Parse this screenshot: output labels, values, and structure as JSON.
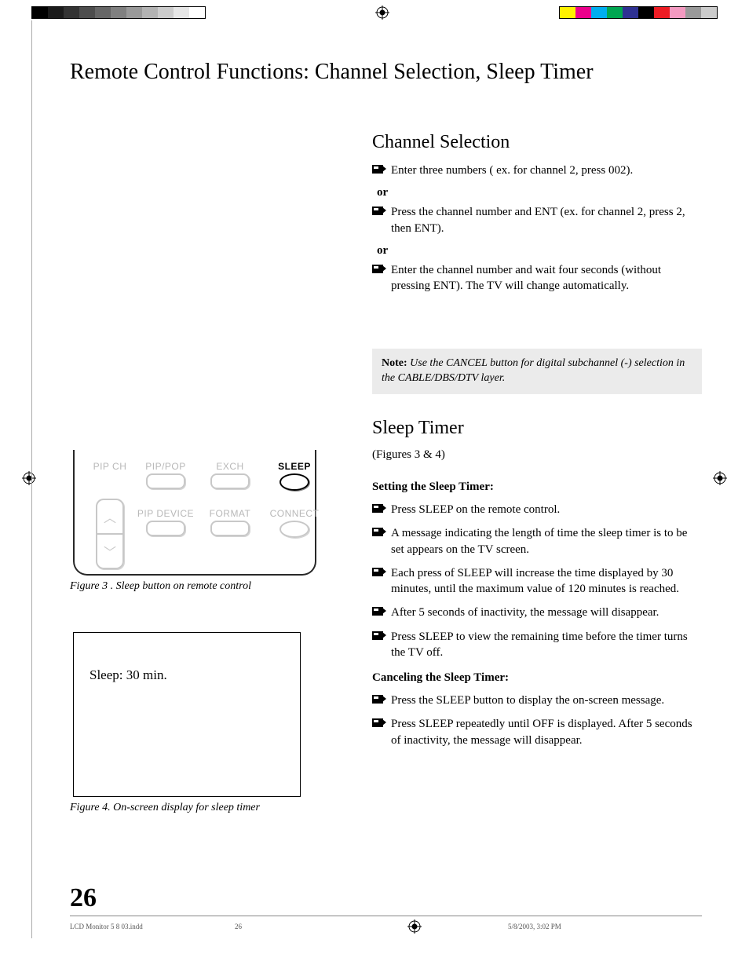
{
  "title": "Remote Control Functions: Channel Selection, Sleep Timer",
  "channel_selection": {
    "heading": "Channel Selection",
    "items": [
      "Enter three numbers ( ex. for channel 2, press 002).",
      "Press the channel number and ENT (ex. for channel 2, press 2, then ENT).",
      "Enter the channel number and wait four seconds (without pressing ENT).  The TV will change automatically."
    ],
    "or": "or"
  },
  "note": {
    "label": "Note:",
    "text": "Use  the CANCEL button for digital subchannel (-) selection in the CABLE/DBS/DTV layer."
  },
  "sleep_timer": {
    "heading": "Sleep Timer",
    "figures_ref": "(Figures 3 & 4)",
    "setting_heading": "Setting the Sleep Timer:",
    "setting_items": [
      "Press SLEEP on the remote control.",
      "A message indicating the length of time the sleep timer is to be set appears on the TV screen.",
      "Each press of SLEEP will increase the time displayed by 30 minutes, until the maximum value of 120 minutes is reached.",
      "After 5 seconds of inactivity, the message will disappear.",
      "Press SLEEP to view the remaining time before the timer turns the TV off."
    ],
    "cancel_heading": "Canceling the Sleep Timer:",
    "cancel_items": [
      "Press the SLEEP button to display the on-screen message.",
      "Press SLEEP repeatedly until OFF is displayed. After 5 seconds of inactivity, the message will disappear."
    ]
  },
  "remote": {
    "labels": {
      "pip_ch": "PIP CH",
      "pip_pop": "PIP/POP",
      "exch": "EXCH",
      "sleep": "SLEEP",
      "pip_device": "PIP DEVICE",
      "format": "FORMAT",
      "connect": "CONNECT"
    }
  },
  "figure3_caption": "Figure 3 . Sleep button on remote control",
  "sleep_box_text": "Sleep: 30 min.",
  "figure4_caption": "Figure 4. On-screen display for sleep timer",
  "page_number": "26",
  "footer": {
    "file": "LCD Monitor 5 8 03.indd",
    "page": "26",
    "date": "5/8/2003, 3:02 PM"
  },
  "swatches": {
    "gray": [
      "#000000",
      "#1a1a1a",
      "#333333",
      "#4d4d4d",
      "#666666",
      "#808080",
      "#999999",
      "#b3b3b3",
      "#cccccc",
      "#e6e6e6",
      "#ffffff"
    ],
    "color": [
      "#fff200",
      "#ec008c",
      "#00aeef",
      "#00a651",
      "#2e3192",
      "#000000",
      "#ed1c24",
      "#f49ac1",
      "#999999",
      "#cccccc"
    ]
  }
}
